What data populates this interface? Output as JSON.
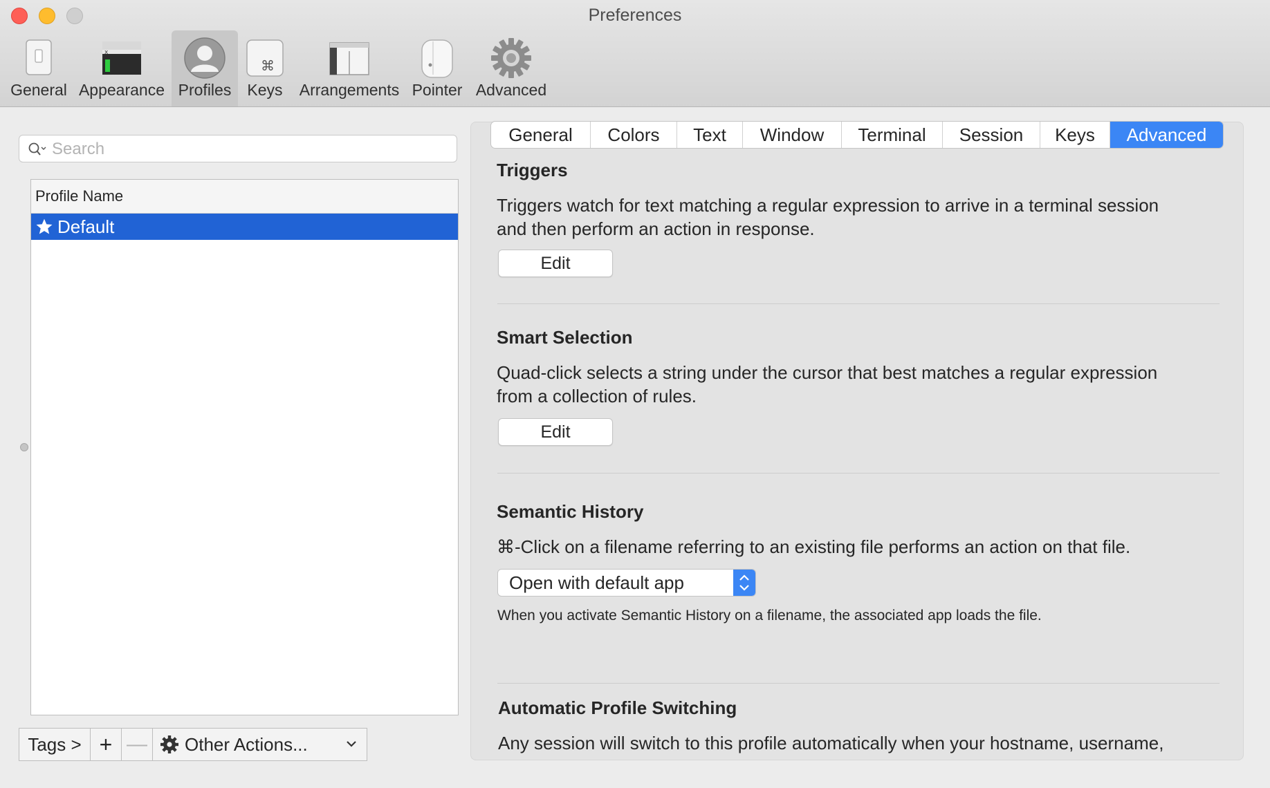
{
  "window": {
    "title": "Preferences"
  },
  "toolbar": {
    "items": [
      {
        "label": "General",
        "icon": "general-icon"
      },
      {
        "label": "Appearance",
        "icon": "appearance-icon"
      },
      {
        "label": "Profiles",
        "icon": "profiles-icon",
        "selected": true
      },
      {
        "label": "Keys",
        "icon": "keys-icon"
      },
      {
        "label": "Arrangements",
        "icon": "arrangements-icon"
      },
      {
        "label": "Pointer",
        "icon": "pointer-icon"
      },
      {
        "label": "Advanced",
        "icon": "gear-icon"
      }
    ]
  },
  "sidebar": {
    "search_placeholder": "Search",
    "column_header": "Profile Name",
    "profiles": [
      {
        "name": "Default",
        "is_default": true,
        "selected": true
      }
    ],
    "bottom": {
      "tags_label": "Tags >",
      "add_label": "+",
      "remove_label": "—",
      "actions_label": "Other Actions..."
    }
  },
  "tabs": {
    "items": [
      "General",
      "Colors",
      "Text",
      "Window",
      "Terminal",
      "Session",
      "Keys",
      "Advanced"
    ],
    "active": "Advanced"
  },
  "sections": {
    "triggers": {
      "title": "Triggers",
      "desc_line1": "Triggers watch for text matching a regular expression to arrive in a terminal session",
      "desc_line2": "and then perform an action in response.",
      "button": "Edit"
    },
    "smart_selection": {
      "title": "Smart Selection",
      "desc_line1": "Quad-click selects a string under the cursor that best matches a regular expression",
      "desc_line2": "from a collection of rules.",
      "button": "Edit"
    },
    "semantic_history": {
      "title": "Semantic History",
      "desc": "⌘-Click on a filename referring to an existing file performs an action on that file.",
      "select_value": "Open with default app",
      "note": "When you activate Semantic History on a filename, the associated app loads the file."
    },
    "auto_switching": {
      "title": "Automatic Profile Switching",
      "desc": "Any session will switch to this profile automatically when your hostname, username,"
    }
  },
  "colors": {
    "accent": "#3b86f5",
    "selection": "#2163d5",
    "close": "#fe5f57",
    "minimize": "#febc2e"
  }
}
